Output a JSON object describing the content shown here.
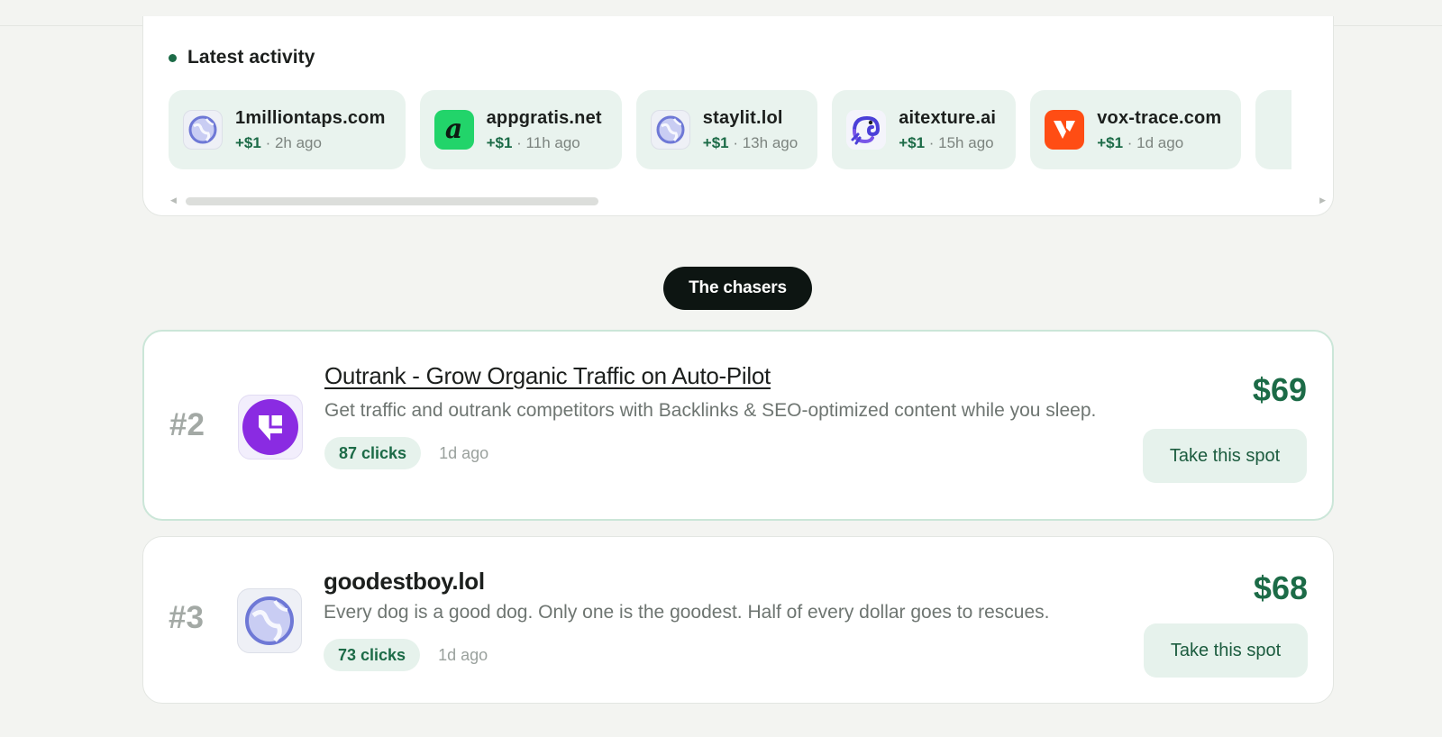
{
  "activity": {
    "title": "Latest activity",
    "items": [
      {
        "name": "1milliontaps.com",
        "amount": "+$1",
        "time": "· 2h ago",
        "icon": "globe-icon"
      },
      {
        "name": "appgratis.net",
        "amount": "+$1",
        "time": "· 11h ago",
        "icon": "appgratis-logo-icon",
        "logo_letter": "a"
      },
      {
        "name": "staylit.lol",
        "amount": "+$1",
        "time": "· 13h ago",
        "icon": "globe-icon"
      },
      {
        "name": "aitexture.ai",
        "amount": "+$1",
        "time": "· 15h ago",
        "icon": "chameleon-logo-icon"
      },
      {
        "name": "vox-trace.com",
        "amount": "+$1",
        "time": "· 1d ago",
        "icon": "vox-logo-icon"
      }
    ]
  },
  "section": {
    "label": "The chasers"
  },
  "ranks": [
    {
      "rank": "#2",
      "title": "Outrank - Grow Organic Traffic on Auto-Pilot",
      "description": "Get traffic and outrank competitors with Backlinks & SEO-optimized content while you sleep.",
      "clicks": "87 clicks",
      "ago": "1d ago",
      "price": "$69",
      "button": "Take this spot",
      "icon": "outrank-logo-icon"
    },
    {
      "rank": "#3",
      "title": "goodestboy.lol",
      "description": "Every dog is a good dog. Only one is the goodest. Half of every dollar goes to rescues.",
      "clicks": "73 clicks",
      "ago": "1d ago",
      "price": "$68",
      "button": "Take this spot",
      "icon": "globe-icon"
    }
  ],
  "colors": {
    "accent_green": "#1c6b47",
    "chip_bg": "#e9f3ee",
    "pill_bg": "#0d1512",
    "page_bg": "#f3f4f1"
  }
}
